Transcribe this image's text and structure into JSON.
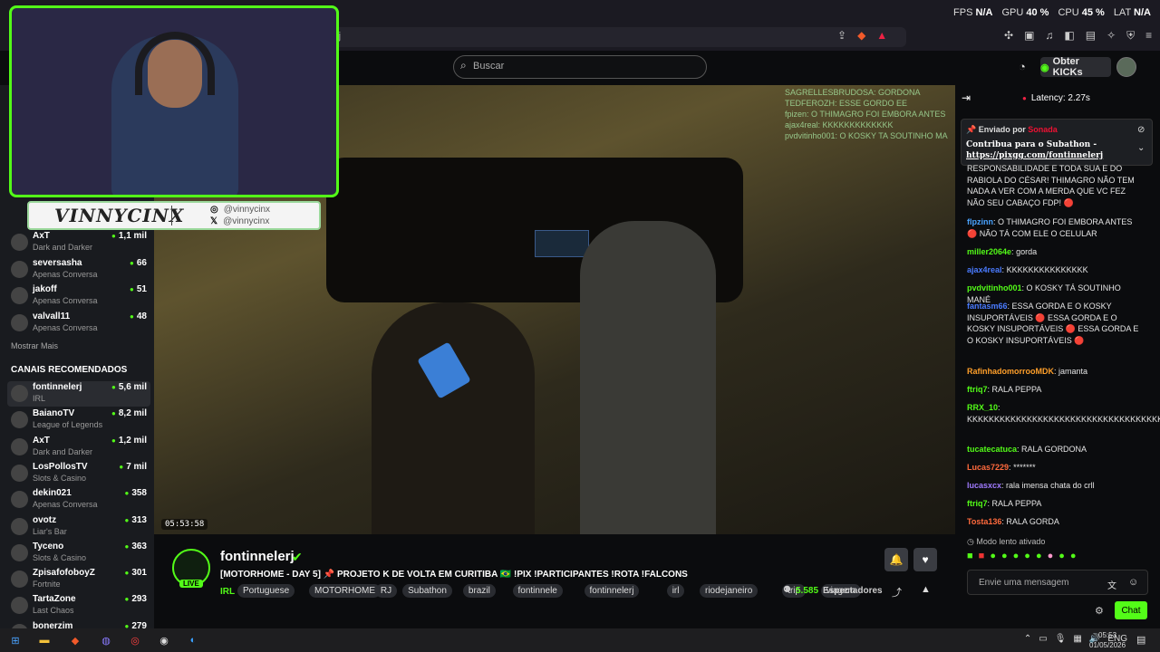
{
  "perf": {
    "fps_label": "FPS",
    "fps": "N/A",
    "gpu_label": "GPU",
    "gpu": "40 %",
    "cpu_label": "CPU",
    "cpu": "45 %",
    "lat_label": "LAT",
    "lat": "N/A"
  },
  "browser": {
    "url_fragment": "rj"
  },
  "header": {
    "search_placeholder": "Buscar",
    "kicks_label": "Obter KICKs"
  },
  "overlay": {
    "name_tag": "VINNYCINX",
    "instagram": "@vinnycinx",
    "x_handle": "@vinnycinx"
  },
  "sidebar": {
    "following": [
      {
        "name": "AxT",
        "game": "Dark and Darker",
        "viewers": "1,1 mil"
      },
      {
        "name": "seversasha",
        "game": "Apenas Conversa",
        "viewers": "66"
      },
      {
        "name": "jakoff",
        "game": "Apenas Conversa",
        "viewers": "51"
      },
      {
        "name": "valvall11",
        "game": "Apenas Conversa",
        "viewers": "48"
      }
    ],
    "show_more": "Mostrar Mais",
    "recommended_title": "CANAIS RECOMENDADOS",
    "recommended": [
      {
        "name": "fontinnelerj",
        "game": "IRL",
        "viewers": "5,6 mil"
      },
      {
        "name": "BaianoTV",
        "game": "League of Legends",
        "viewers": "8,2 mil"
      },
      {
        "name": "AxT",
        "game": "Dark and Darker",
        "viewers": "1,2 mil"
      },
      {
        "name": "LosPollosTV",
        "game": "Slots & Casino",
        "viewers": "7 mil"
      },
      {
        "name": "dekin021",
        "game": "Apenas Conversa",
        "viewers": "358"
      },
      {
        "name": "ovotz",
        "game": "Liar's Bar",
        "viewers": "313"
      },
      {
        "name": "Tyceno",
        "game": "Slots & Casino",
        "viewers": "363"
      },
      {
        "name": "ZpisafofoboyZ",
        "game": "Fortnite",
        "viewers": "301"
      },
      {
        "name": "TartaZone",
        "game": "Last Chaos",
        "viewers": "293"
      },
      {
        "name": "bonerzim",
        "game": "",
        "viewers": "279"
      }
    ]
  },
  "video": {
    "timestamp": "05:53:58",
    "overlay_chat": [
      "SAGRELLESBRUDOSA: GORDONA",
      "TEDFEROZH: ESSE GORDO EE",
      "fpizen: O THIMAGRO FOI EMBORA ANTES",
      "ajax4real: KKKKKKKKKKKKK",
      "pvdvitinho001: O KOSKY TA SOUTINHO MA"
    ]
  },
  "stream": {
    "streamer": "fontinnelerj",
    "live": "LIVE",
    "title": "[MOTORHOME - DAY 5] 📌 PROJETO K DE VOLTA EM CURITIBA 🇧🇷 !PIX !PARTICIPANTES !ROTA !FALCONS",
    "category": "IRL",
    "tags": [
      "Portuguese",
      "MOTORHOME",
      "RJ",
      "Subathon",
      "brazil",
      "fontinnele",
      "fontinnelerj",
      "irl",
      "riodejaneiro",
      "trip",
      "viagem"
    ],
    "viewers": "5.585",
    "viewers_label": "Espectadores"
  },
  "chat": {
    "latency": "Latency: 2.27s",
    "pinned_by_label": "Enviado por",
    "pinned_by_user": "Sonada",
    "pinned_text": "Contribua para o Subathon -",
    "pinned_link": "https://pixgg.com/fontinnelerj",
    "messages": [
      {
        "user": "",
        "color": "#e6e6e6",
        "text": "RESPONSABILIDADE E TODA SUA E DO RABIOLA DO CÉSAR! THIMAGRO NÃO TEM NADA A VER COM A MERDA QUE VC FEZ NÃO SEU CABAÇO FDP! 🔴"
      },
      {
        "user": "flpzinn",
        "color": "#4aa3ff",
        "text": "O THIMAGRO FOI EMBORA ANTES 🔴 NÃO TÁ COM ELE O CELULAR"
      },
      {
        "user": "miller2064e",
        "color": "#53fc18",
        "text": "gorda"
      },
      {
        "user": "ajax4real",
        "color": "#4a7bff",
        "text": "KKKKKKKKKKKKKKK"
      },
      {
        "user": "pvdvitinho001",
        "color": "#53fc18",
        "text": "O KOSKY TÁ SOUTINHO MANÉ"
      },
      {
        "user": "fantasm66",
        "color": "#4a7bff",
        "text": "ESSA GORDA E O KOSKY INSUPORTÁVEIS 🔴 ESSA GORDA E O KOSKY INSUPORTÁVEIS 🔴 ESSA GORDA E O KOSKY INSUPORTÁVEIS 🔴"
      },
      {
        "user": "RafinhadomorrooMDK",
        "color": "#ff9f2a",
        "text": "jamanta"
      },
      {
        "user": "ftriq7",
        "color": "#53fc18",
        "text": "RALA PEPPA"
      },
      {
        "user": "RRX_10",
        "color": "#53fc18",
        "text": "KKKKKKKKKKKKKKKKKKKKKKKKKKKKKKKKKKKK"
      },
      {
        "user": "tucatecatuca",
        "color": "#53fc18",
        "text": "RALA GORDONA"
      },
      {
        "user": "Lucas7229",
        "color": "#ff6a3d",
        "text": "*******"
      },
      {
        "user": "lucasxcx",
        "color": "#a07bff",
        "text": "rala imensa chata do crll"
      },
      {
        "user": "ftriq7",
        "color": "#53fc18",
        "text": "RALA PEPPA"
      },
      {
        "user": "Tosta136",
        "color": "#ff6a3d",
        "text": "RALA GORDA"
      }
    ],
    "slow_mode": "Modo lento ativado",
    "input_placeholder": "Envie uma mensagem",
    "send_label": "Chat"
  },
  "taskbar": {
    "lang": "ENG",
    "time": "05:53",
    "date": "01/05/2026"
  },
  "colors": {
    "accent": "#53fc18",
    "background": "#0b0c0e",
    "sidebar": "#191b1f"
  }
}
